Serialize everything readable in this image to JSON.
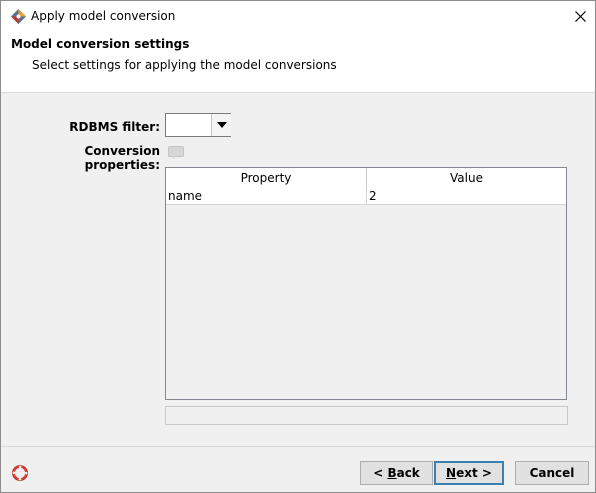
{
  "window": {
    "title": "Apply model conversion",
    "app_icon": "app-logo-icon",
    "close_icon": "close-icon"
  },
  "header": {
    "title": "Model conversion settings",
    "subtitle": "Select settings for applying the model conversions"
  },
  "form": {
    "rdbms_filter_label": "RDBMS filter:",
    "rdbms_filter_value": "",
    "conversion_properties_label": "Conversion properties:"
  },
  "table": {
    "columns": [
      "Property",
      "Value"
    ],
    "rows": [
      {
        "property": "name",
        "value": "2"
      }
    ]
  },
  "footer": {
    "help_icon": "help-lifebuoy-icon",
    "back_prefix": "< ",
    "back_mnemonic": "B",
    "back_rest": "ack",
    "next_mnemonic": "N",
    "next_rest": "ext >",
    "cancel_label": "Cancel"
  },
  "colors": {
    "accent": "#3c7fb1",
    "help_icon": "#e03c31"
  }
}
